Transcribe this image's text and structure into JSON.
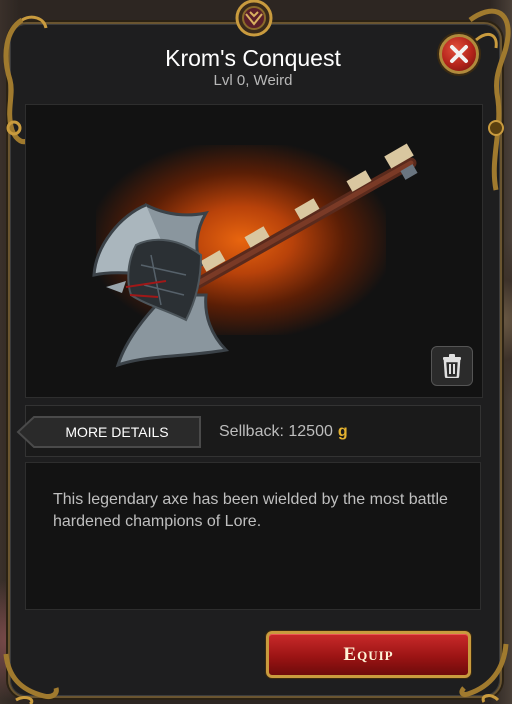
{
  "item": {
    "name": "Krom's Conquest",
    "meta": "Lvl 0, Weird",
    "description": "This legendary axe has been wielded by the most battle hardened champions of Lore."
  },
  "actions": {
    "more_details_label": "MORE DETAILS",
    "sellback_label": "Sellback: 12500",
    "currency_symbol": "g",
    "equip_label": "Equip"
  },
  "icons": {
    "close": "close-icon",
    "trash": "trash-icon",
    "crest": "crest-icon"
  },
  "colors": {
    "panel_bg": "#1e1e1f",
    "gold_accent": "#c99b3e",
    "currency_gold": "#e3b12f",
    "equip_red": "#9c1414",
    "glow_orange": "#e8650f"
  }
}
